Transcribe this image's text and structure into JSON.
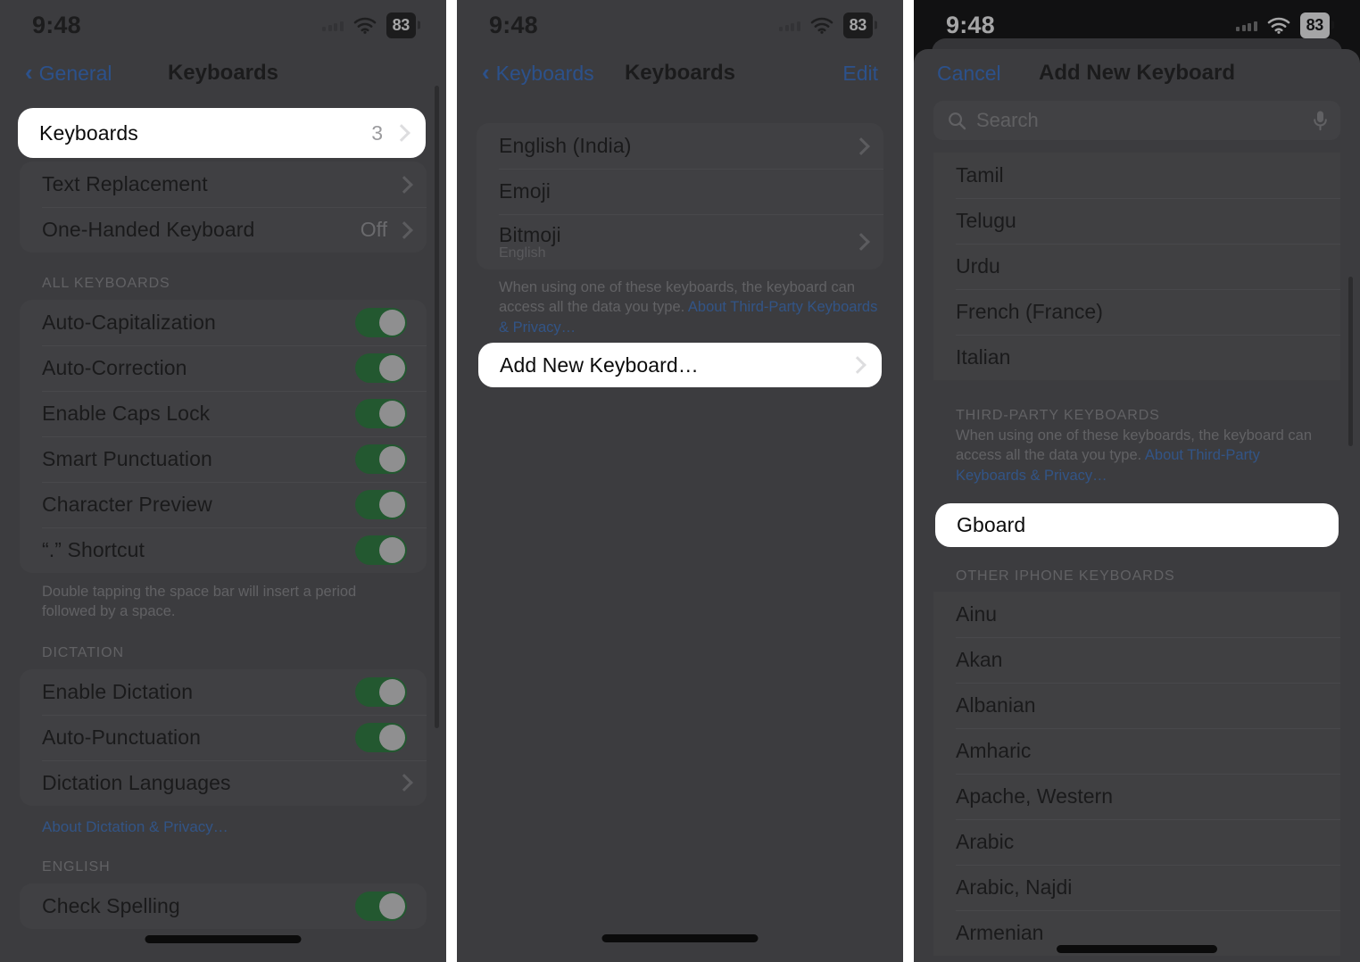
{
  "status_bar": {
    "time": "9:48",
    "battery": "83",
    "wifi_icon": "wifi-icon",
    "signal_icon": "cellular-signal-icon"
  },
  "panel1": {
    "nav": {
      "back_label": "General",
      "title": "Keyboards",
      "back_icon": "chevron-left-icon"
    },
    "highlight_row": {
      "label": "Keyboards",
      "value": "3",
      "chevron_icon": "chevron-right-icon"
    },
    "group_top": [
      {
        "label": "Text Replacement",
        "value": "",
        "type": "disclosure"
      },
      {
        "label": "One-Handed Keyboard",
        "value": "Off",
        "type": "disclosure"
      }
    ],
    "all_keyboards_header": "ALL KEYBOARDS",
    "all_keyboards": [
      {
        "label": "Auto-Capitalization",
        "toggle": "on"
      },
      {
        "label": "Auto-Correction",
        "toggle": "on"
      },
      {
        "label": "Enable Caps Lock",
        "toggle": "on"
      },
      {
        "label": "Smart Punctuation",
        "toggle": "on"
      },
      {
        "label": "Character Preview",
        "toggle": "on"
      },
      {
        "label": "“.” Shortcut",
        "toggle": "on"
      }
    ],
    "all_keyboards_footer": "Double tapping the space bar will insert a period followed by a space.",
    "dictation_header": "DICTATION",
    "dictation": [
      {
        "label": "Enable Dictation",
        "toggle": "on"
      },
      {
        "label": "Auto-Punctuation",
        "toggle": "on"
      },
      {
        "label": "Dictation Languages",
        "type": "disclosure"
      }
    ],
    "dictation_link": "About Dictation & Privacy…",
    "english_header": "ENGLISH",
    "english": [
      {
        "label": "Check Spelling",
        "toggle": "on"
      }
    ]
  },
  "panel2": {
    "nav": {
      "back_label": "Keyboards",
      "title": "Keyboards",
      "edit_label": "Edit",
      "back_icon": "chevron-left-icon"
    },
    "keyboards": [
      {
        "label": "English (India)",
        "sub": "",
        "type": "disclosure"
      },
      {
        "label": "Emoji",
        "sub": "",
        "type": "plain"
      },
      {
        "label": "Bitmoji",
        "sub": "English",
        "type": "disclosure"
      }
    ],
    "footer_text": "When using one of these keyboards, the keyboard can access all the data you type. ",
    "footer_link": "About Third-Party Keyboards & Privacy…",
    "highlight_row": {
      "label": "Add New Keyboard…",
      "chevron_icon": "chevron-right-icon"
    }
  },
  "panel3": {
    "nav": {
      "cancel_label": "Cancel",
      "title": "Add New Keyboard"
    },
    "search": {
      "placeholder": "Search",
      "search_icon": "search-icon",
      "mic_icon": "microphone-icon"
    },
    "suggested": [
      "Tamil",
      "Telugu",
      "Urdu",
      "French (France)",
      "Italian"
    ],
    "third_party_header": "THIRD-PARTY KEYBOARDS",
    "third_party_footer_text": "When using one of these keyboards, the keyboard can access all the data you type. ",
    "third_party_footer_link": "About Third-Party Keyboards & Privacy…",
    "highlight_row": {
      "label": "Gboard"
    },
    "other_header": "OTHER IPHONE KEYBOARDS",
    "other": [
      "Ainu",
      "Akan",
      "Albanian",
      "Amharic",
      "Apache, Western",
      "Arabic",
      "Arabic, Najdi",
      "Armenian"
    ]
  },
  "colors": {
    "accent_blue": "#2f6fd0",
    "toggle_green": "#1f7a34",
    "highlight_bg": "#ffffff",
    "panel_bg": "#4b4b4e"
  }
}
